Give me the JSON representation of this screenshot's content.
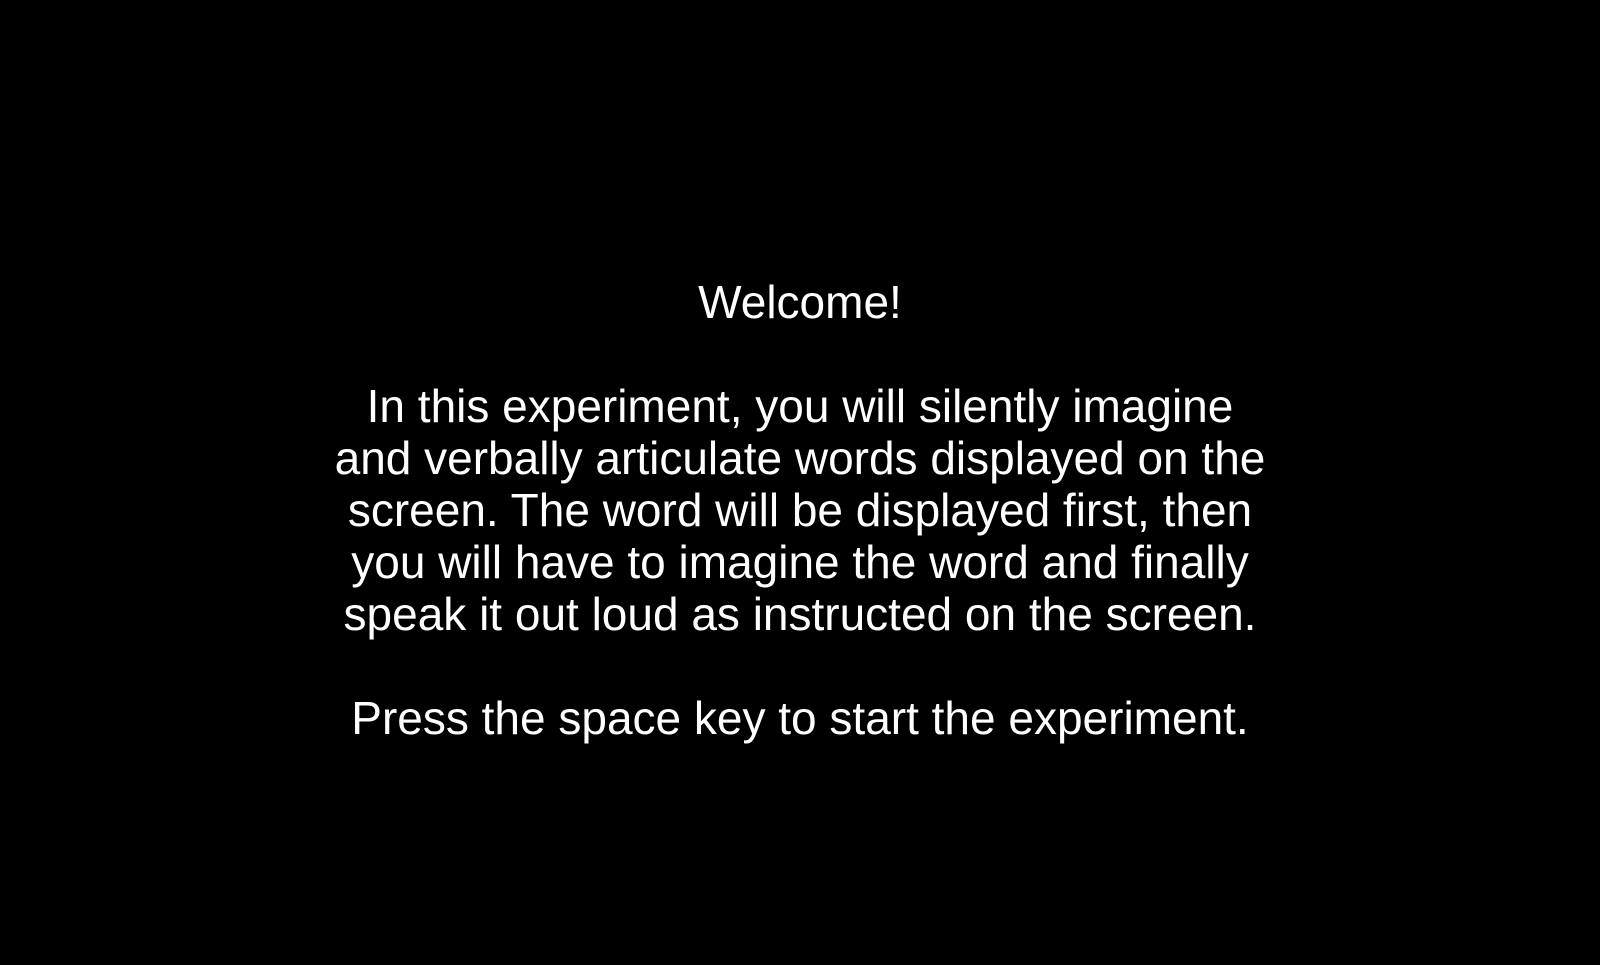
{
  "screen": {
    "background_color": "#000000",
    "text_color": "#ffffff",
    "title": "Welcome!",
    "body_lines": [
      "In this experiment, you will silently imagine",
      "and verbally articulate words displayed on the",
      "screen. The word will be displayed first, then",
      "you will have to imagine the word and finally",
      "speak it out loud as instructed on the screen."
    ],
    "prompt": "Press the space key to start the experiment."
  }
}
